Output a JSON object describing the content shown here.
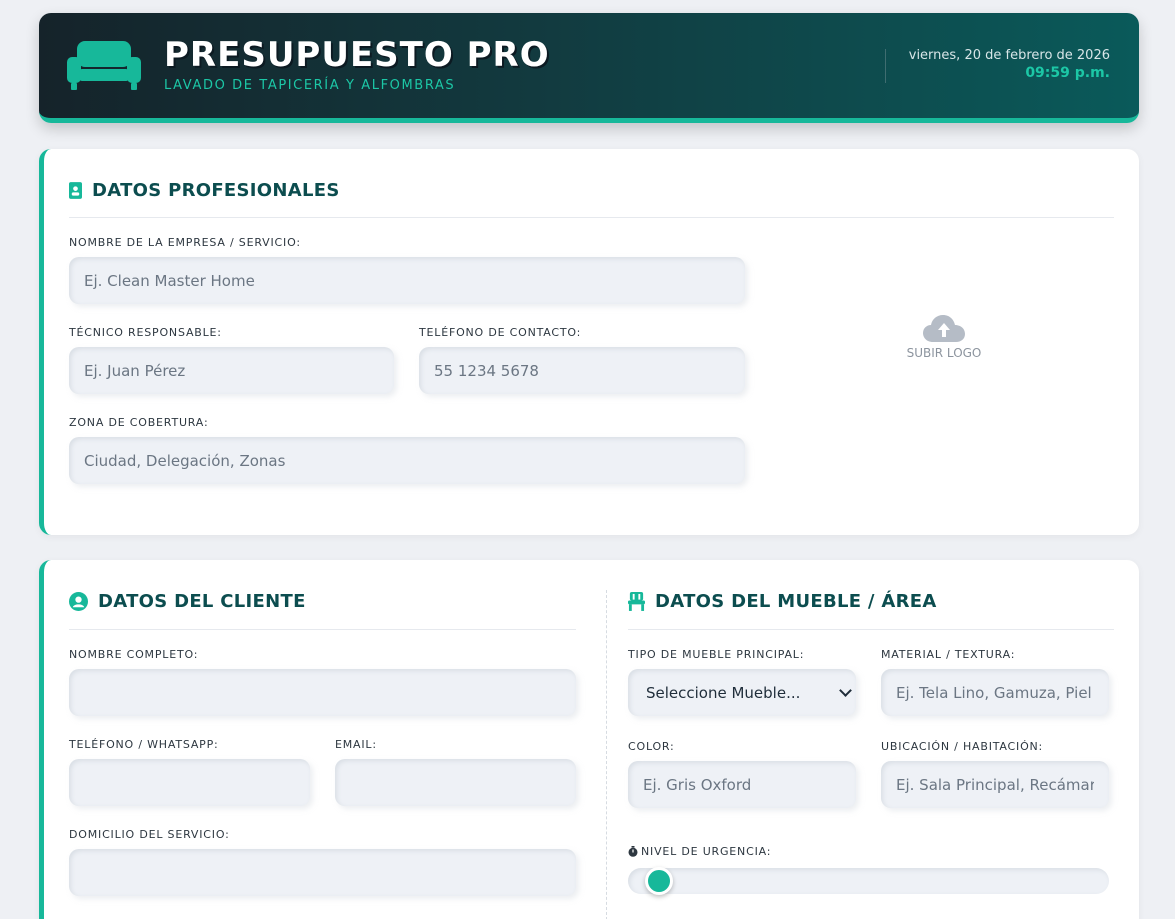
{
  "header": {
    "title": "PRESUPUESTO PRO",
    "subtitle": "LAVADO DE TAPICERÍA Y ALFOMBRAS",
    "date": "viernes, 20 de febrero de 2026",
    "time": "09:59 p.m.",
    "icon": "sofa-icon"
  },
  "colors": {
    "accent": "#17b89a",
    "title_dark": "#0c4d4f",
    "header_bg_start": "#15232a",
    "header_bg_end": "#0a5a5a"
  },
  "professional": {
    "title": "DATOS PROFESIONALES",
    "icon": "id-badge-icon",
    "company_label": "NOMBRE DE LA EMPRESA / SERVICIO:",
    "company_placeholder": "Ej. Clean Master Home",
    "tech_label": "TÉCNICO RESPONSABLE:",
    "tech_placeholder": "Ej. Juan Pérez",
    "phone_label": "TELÉFONO DE CONTACTO:",
    "phone_placeholder": "55 1234 5678",
    "zone_label": "ZONA DE COBERTURA:",
    "zone_placeholder": "Ciudad, Delegación, Zonas",
    "upload_label": "SUBIR LOGO"
  },
  "client": {
    "title": "DATOS DEL CLIENTE",
    "icon": "user-circle-icon",
    "name_label": "NOMBRE COMPLETO:",
    "name_value": "",
    "phone_label": "TELÉFONO / WHATSAPP:",
    "phone_value": "",
    "email_label": "EMAIL:",
    "email_value": "",
    "address_label": "DOMICILIO DEL SERVICIO:",
    "address_value": ""
  },
  "furniture": {
    "title": "DATOS DEL MUEBLE / ÁREA",
    "icon": "chair-icon",
    "type_label": "TIPO DE MUEBLE PRINCIPAL:",
    "type_selected": "Seleccione Mueble...",
    "material_label": "MATERIAL / TEXTURA:",
    "material_placeholder": "Ej. Tela Lino, Gamuza, Piel",
    "color_label": "COLOR:",
    "color_placeholder": "Ej. Gris Oxford",
    "location_label": "UBICACIÓN / HABITACIÓN:",
    "location_placeholder": "Ej. Sala Principal, Recámara Mas",
    "urgency_label": "NIVEL DE URGENCIA:",
    "urgency_icon": "stopwatch-icon",
    "urgency_level": 0
  }
}
